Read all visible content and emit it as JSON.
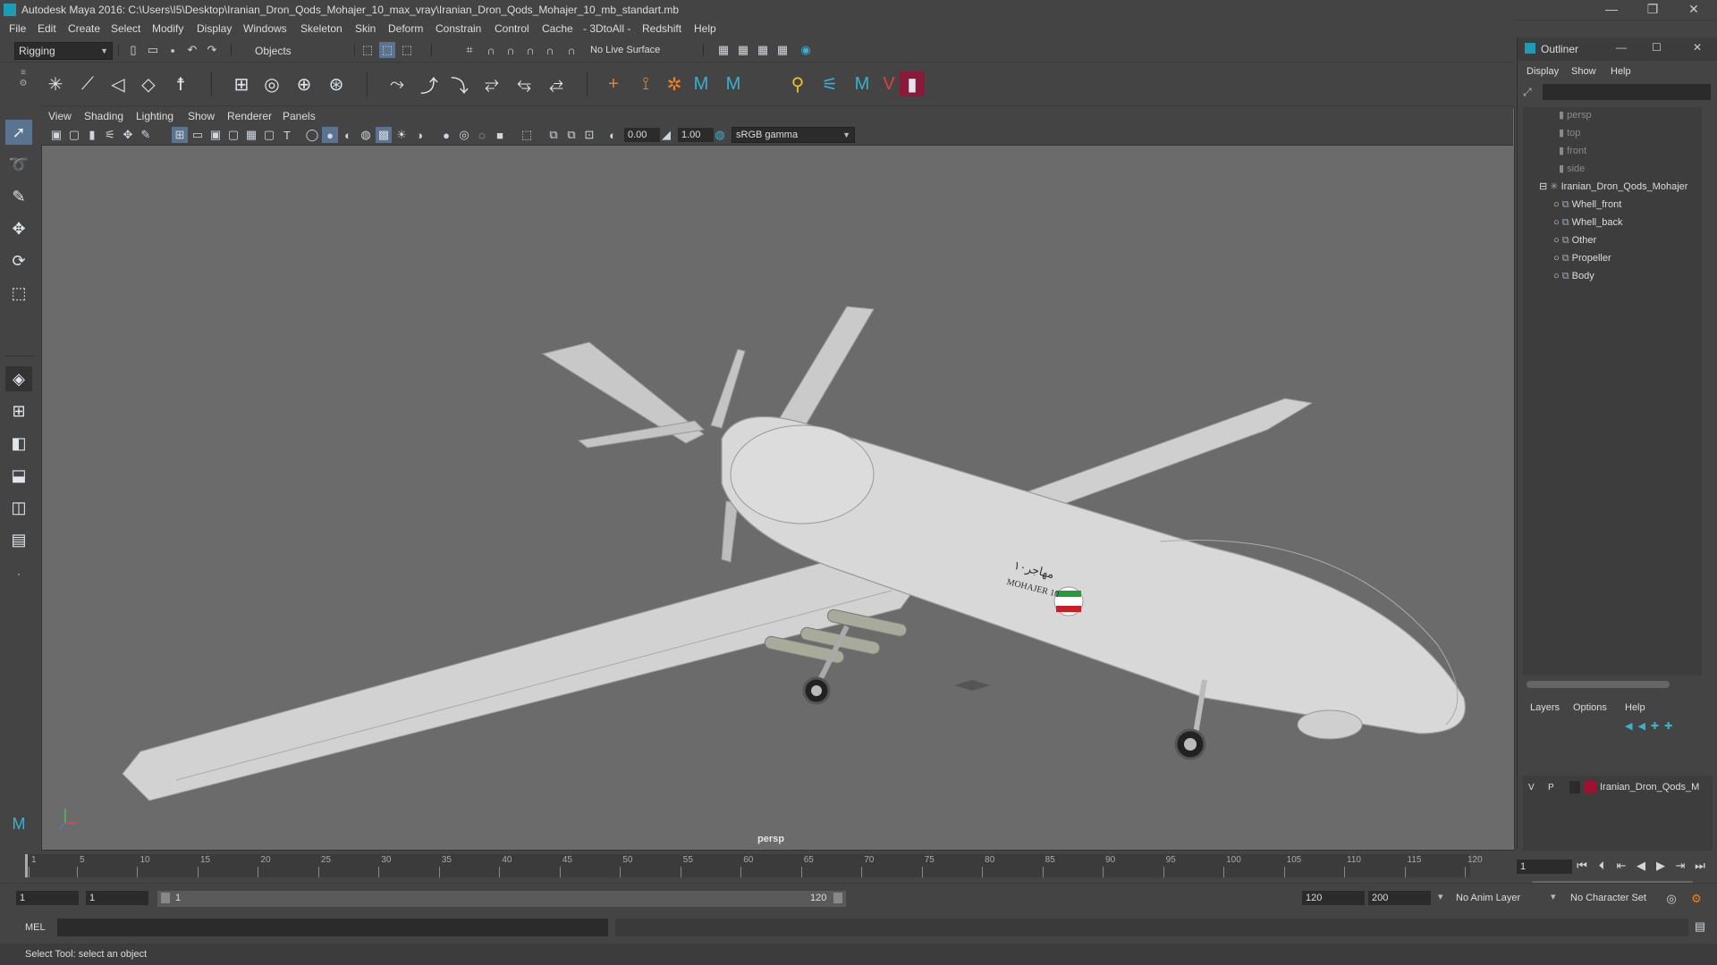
{
  "window": {
    "title": "Autodesk Maya 2016: C:\\Users\\I5\\Desktop\\Iranian_Dron_Qods_Mohajer_10_max_vray\\Iranian_Dron_Qods_Mohajer_10_mb_standart.mb",
    "minimize": "—",
    "restore": "❐",
    "close": "✕"
  },
  "menus": [
    "File",
    "Edit",
    "Create",
    "Select",
    "Modify",
    "Display",
    "Windows",
    "Skeleton",
    "Skin",
    "Deform",
    "Constrain",
    "Control",
    "Cache",
    "- 3DtoAll -",
    "Redshift",
    "Help"
  ],
  "statusline": {
    "mode": "Rigging",
    "selection_mode": "Objects",
    "live_surface": "No Live Surface"
  },
  "panel": {
    "menus": [
      "View",
      "Shading",
      "Lighting",
      "Show",
      "Renderer",
      "Panels"
    ],
    "exposure": "0.00",
    "gamma": "1.00",
    "color_space": "sRGB gamma",
    "camera_label": "persp"
  },
  "model": {
    "name_arabic": "مهاجر۱۰",
    "name_latin": "MOHAJER 10"
  },
  "outliner": {
    "title": "Outliner",
    "menus": [
      "Display",
      "Show",
      "Help"
    ],
    "cameras": [
      "persp",
      "top",
      "front",
      "side"
    ],
    "group": "Iranian_Dron_Qods_Mohajer",
    "children": [
      "Whell_front",
      "Whell_back",
      "Other",
      "Propeller",
      "Body"
    ]
  },
  "layers": {
    "menus": [
      "Layers",
      "Options",
      "Help"
    ],
    "visible": "V",
    "playback": "P",
    "layer_name": "Iranian_Dron_Qods_M",
    "layer_color": "#a01030"
  },
  "timeline": {
    "ticks": [
      1,
      5,
      10,
      15,
      20,
      25,
      30,
      35,
      40,
      45,
      50,
      55,
      60,
      65,
      70,
      75,
      80,
      85,
      90,
      95,
      100,
      105,
      110,
      115,
      120
    ],
    "current_frame": "1"
  },
  "range": {
    "start": "1",
    "playback_start": "1",
    "slider_start": "1",
    "slider_end": "120",
    "playback_end": "120",
    "end": "200",
    "anim_layer": "No Anim Layer",
    "character_set": "No Character Set"
  },
  "cmd": {
    "language": "MEL"
  },
  "help": {
    "text": "Select Tool: select an object"
  }
}
